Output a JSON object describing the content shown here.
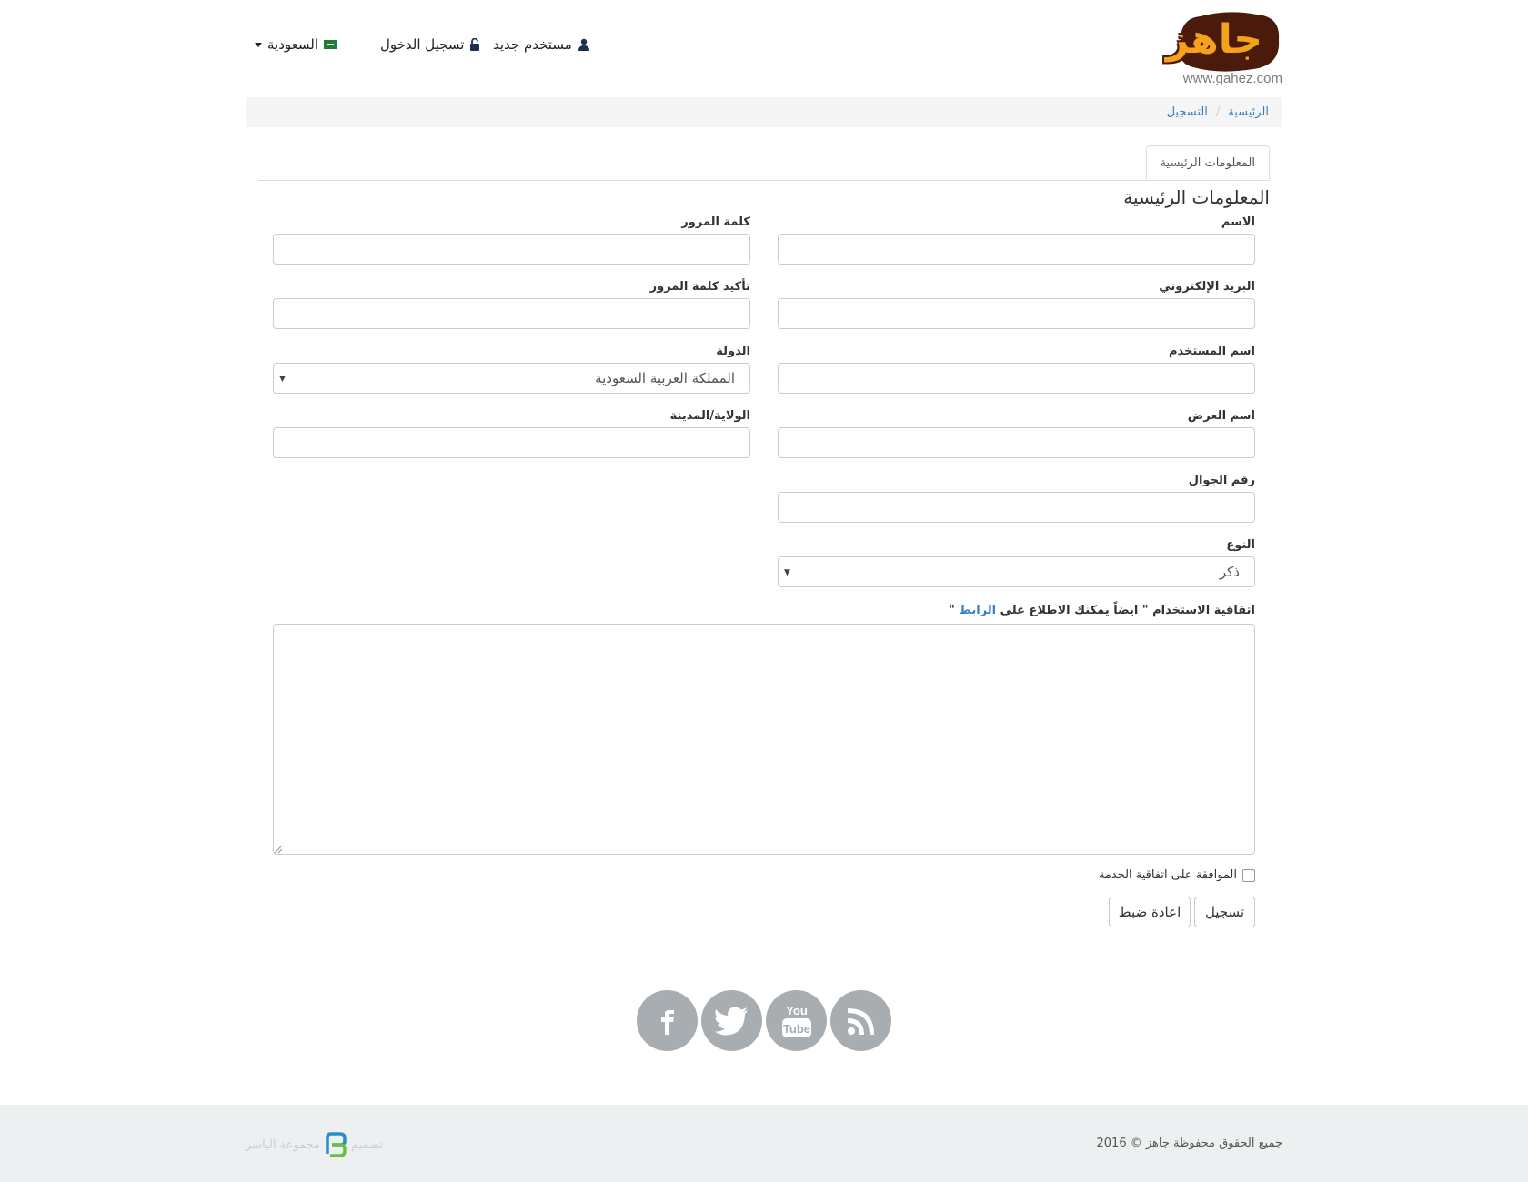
{
  "header": {
    "logo_text": "جاهز",
    "logo_url_text": "www.gahez.com",
    "nav": {
      "new_user": "مستخدم جديد",
      "login": "تسجيل الدخول",
      "country": "السعودية"
    }
  },
  "breadcrumb": {
    "home": "الرئيسية",
    "current": "التسجيل"
  },
  "tabs": [
    {
      "label": "المعلومات الرئيسية"
    }
  ],
  "section_title": "المعلومات الرئيسية",
  "form": {
    "name_label": "الاسم",
    "email_label": "البريد الإلكتروني",
    "username_label": "اسم المستخدم",
    "display_name_label": "اسم العرض",
    "mobile_label": "رقم الجوال",
    "gender_label": "النوع",
    "gender_value": "ذكر",
    "password_label": "كلمة المرور",
    "confirm_password_label": "تأكيد كلمة المرور",
    "country_label": "الدولة",
    "country_value": "المملكة العربية السعودية",
    "city_label": "الولاية/المدينة",
    "agreement_label_prefix": "اتفاقية الاستخدام \" ايضاً يمكنك الاطلاع على ",
    "agreement_link": "الرابط",
    "agreement_label_suffix": " \"",
    "agree_checkbox_label": "الموافقة على اتفاقية الخدمة",
    "submit_label": "تسجيل",
    "reset_label": "اعادة ضبط"
  },
  "social": [
    "facebook-icon",
    "twitter-icon",
    "youtube-icon",
    "rss-icon"
  ],
  "footer": {
    "copyright": "جميع الحقوق محفوظة جاهز © 2016",
    "credit_prefix": "تصميم",
    "credit_company": "مجموعة الياسر"
  },
  "colors": {
    "link": "#3a7fc1",
    "social_bg": "#a8adb1",
    "footer_bg": "#edf0f1",
    "logo_orange": "#f5a21b"
  }
}
